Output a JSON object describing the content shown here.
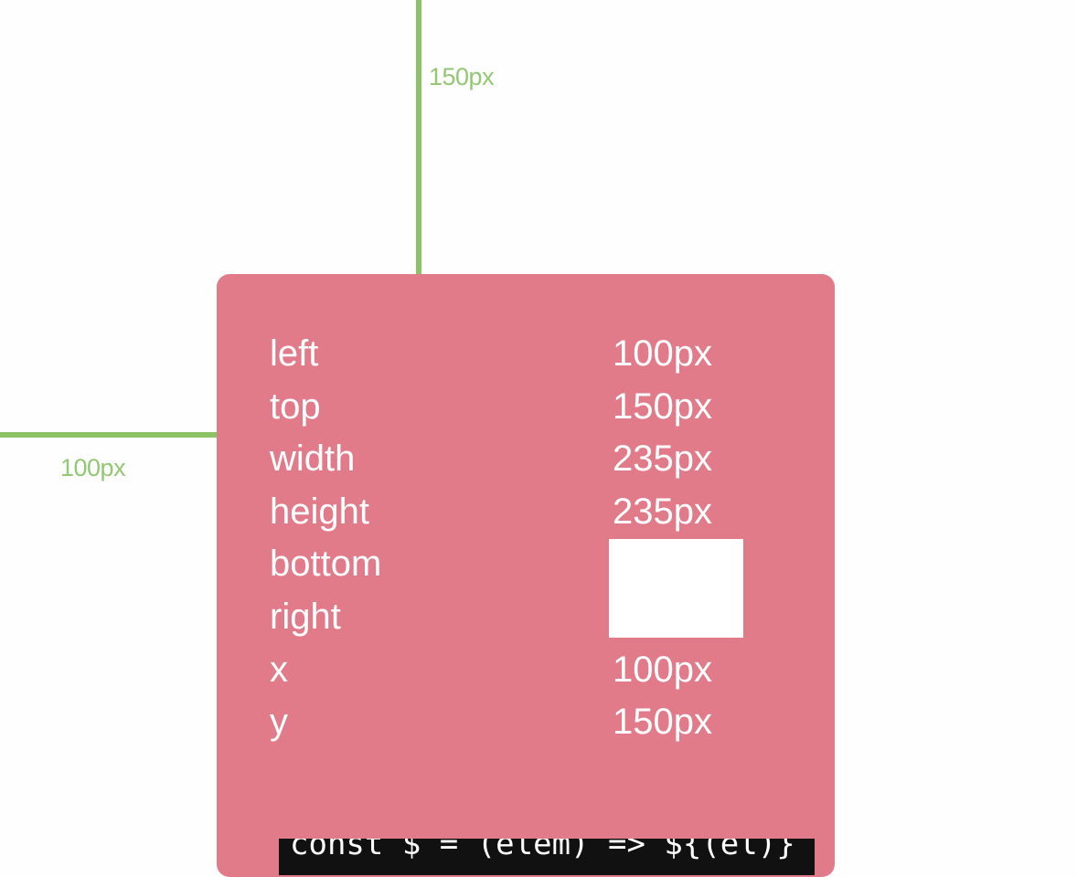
{
  "guides": {
    "top_label": "150px",
    "left_label": "100px",
    "color": "#8cc365"
  },
  "box": {
    "color": "#e17b8a",
    "properties": [
      {
        "name": "left",
        "value": "100px"
      },
      {
        "name": "top",
        "value": "150px"
      },
      {
        "name": "width",
        "value": "235px"
      },
      {
        "name": "height",
        "value": "235px"
      },
      {
        "name": "bottom",
        "value": ""
      },
      {
        "name": "right",
        "value": ""
      },
      {
        "name": "x",
        "value": "100px"
      },
      {
        "name": "y",
        "value": "150px"
      }
    ]
  },
  "code": {
    "visible_fragment": "const $ = (elem) => ${(el)} {"
  }
}
